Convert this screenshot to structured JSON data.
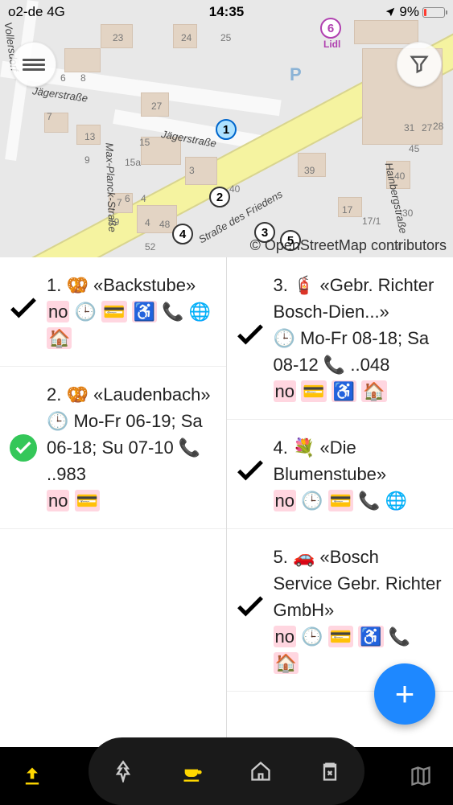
{
  "status": {
    "carrier": "o2-de  4G",
    "time": "14:35",
    "battery_pct": "9%"
  },
  "map": {
    "attribution": "© OpenStreetMap contributors",
    "streets": [
      "Jägerstraße",
      "Max-Planck-Straße",
      "Hainbergstraße",
      "Straße des Friedens",
      "Vollersdorf"
    ],
    "pins": [
      {
        "n": "1"
      },
      {
        "n": "2"
      },
      {
        "n": "3"
      },
      {
        "n": "4"
      },
      {
        "n": "5"
      },
      {
        "n": "6"
      }
    ],
    "lidl": "Lidl",
    "parking": "P"
  },
  "items": [
    {
      "num": "1.",
      "icon": "🥨",
      "title": "«Backstube»",
      "line2": "no 🕒 💳 ♿ 📞 🌐",
      "line3": "🏠",
      "check": "plain"
    },
    {
      "num": "2.",
      "icon": "🥨",
      "title": "«Laudenbach»",
      "line2": "🕒 Mo-Fr 06-19; Sa 06-18; Su 07-10 📞 ..983",
      "line3": "no 💳",
      "check": "done"
    },
    {
      "num": "3.",
      "icon": "🧯",
      "title": "«Gebr. Richter Bosch-Dien...»",
      "line2": "🕒 Mo-Fr 08-18; Sa 08-12 📞 ..048",
      "line3": "no 💳 ♿ 🏠",
      "check": "plain"
    },
    {
      "num": "4.",
      "icon": "💐",
      "title": "«Die Blumenstube»",
      "line2": "no 🕒 💳 📞 🌐",
      "line3": "",
      "check": "plain"
    },
    {
      "num": "5.",
      "icon": "🚗",
      "title": "«Bosch Service Gebr. Richter GmbH»",
      "line2": "no 🕒 💳 ♿ 📞",
      "line3": "🏠",
      "check": "plain"
    }
  ],
  "no_label": "no"
}
